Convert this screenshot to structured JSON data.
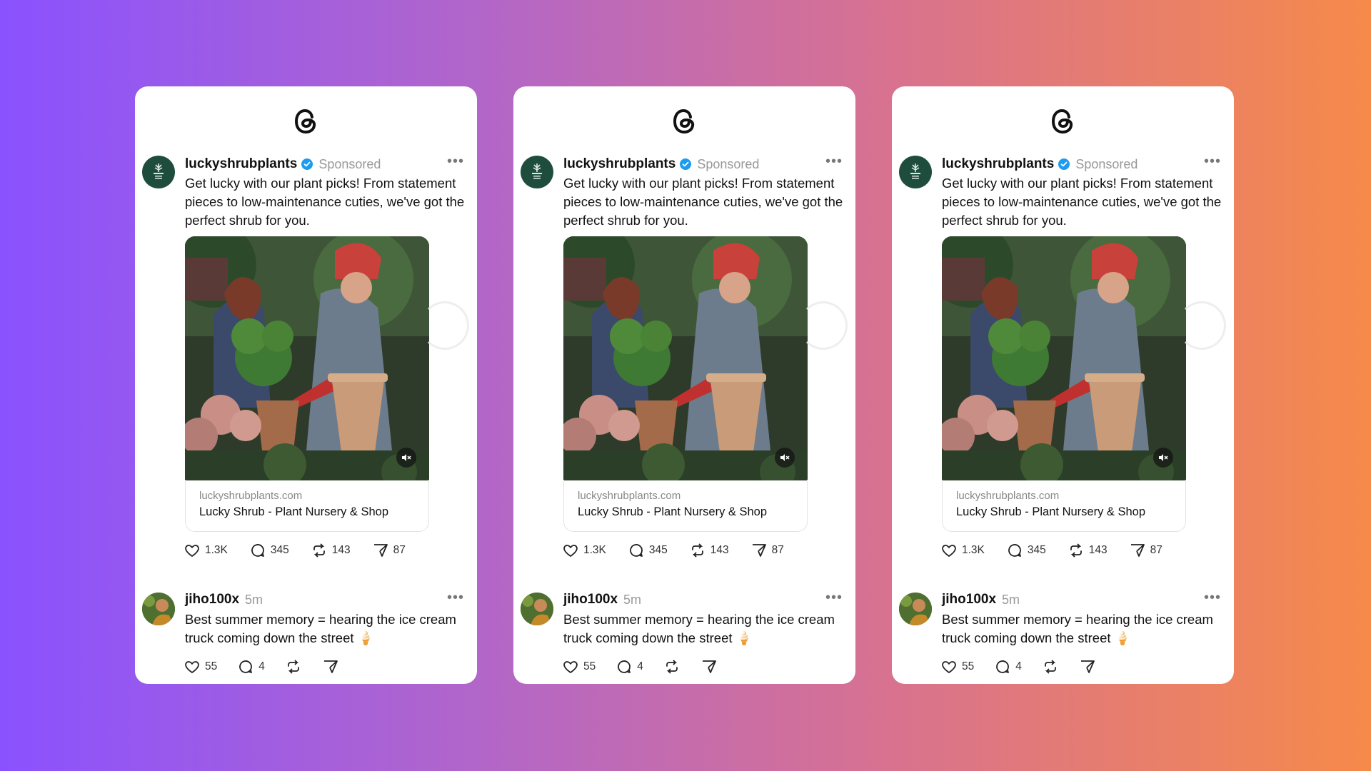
{
  "colors": {
    "gradient_start": "#8a52ff",
    "gradient_end": "#f68a4a",
    "verified": "#1d9bf0"
  },
  "post": {
    "username": "luckyshrubplants",
    "sponsored_label": "Sponsored",
    "more_label": "•••",
    "caption": "Get lucky with our plant picks! From statement pieces to low-maintenance cuties, we've got the perfect shrub for you.",
    "link_domain": "luckyshrubplants.com",
    "link_title": "Lucky Shrub - Plant Nursery & Shop",
    "likes": "1.3K",
    "comments": "345",
    "reposts": "143",
    "shares": "87"
  },
  "reply": {
    "username": "jiho100x",
    "time": "5m",
    "more_label": "•••",
    "text": "Best summer memory = hearing the ice cream truck coming down the street 🍦",
    "likes": "55",
    "comments": "4"
  }
}
